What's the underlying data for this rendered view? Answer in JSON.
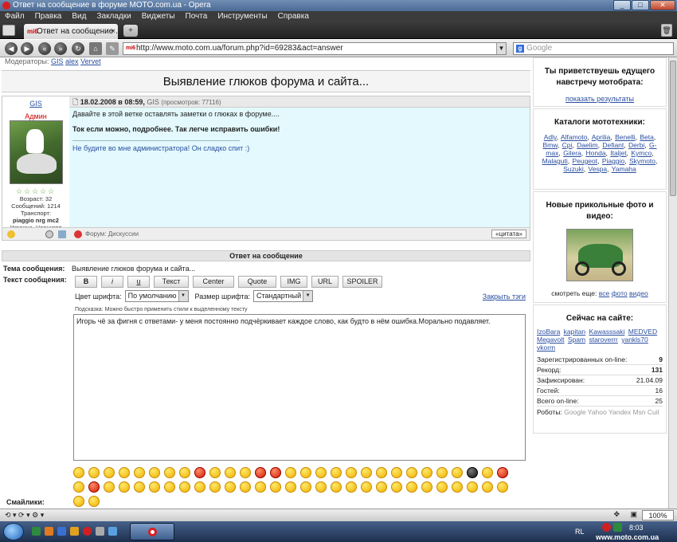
{
  "window": {
    "title": "Ответ на сообщение в форуме MOTO.com.ua - Opera",
    "minimize": "_",
    "maximize": "□",
    "close": "✕"
  },
  "menu": [
    "Файл",
    "Правка",
    "Вид",
    "Закладки",
    "Виджеты",
    "Почта",
    "Инструменты",
    "Справка"
  ],
  "tab": {
    "label": "Ответ на сообщение ...",
    "favicon": "mi6",
    "close": "×",
    "new_tab": "+"
  },
  "address": {
    "url": "http://www.moto.com.ua/forum.php?id=69283&act=answer",
    "favicon": "mi6"
  },
  "search": {
    "placeholder": "Google",
    "engine": "g"
  },
  "nav_icons": [
    "back",
    "forward",
    "rewind",
    "fast-forward",
    "reload",
    "home",
    "wand"
  ],
  "forum": {
    "moderators_label": "Модераторы:",
    "moderators": [
      "GIS",
      "alex",
      "Vervet"
    ],
    "topic_title": "Выявление глюков форума и сайта...",
    "post": {
      "author": "GIS",
      "rank": "Админ",
      "stars": "☆☆☆☆☆",
      "age": "Возраст: 32",
      "posts": "Сообщений: 1214",
      "transport_label": "Транспорт:",
      "transport": "piaggio nrg mc2",
      "location": "Украина, Чернигов",
      "date": "18.02.2008 в 08:59,",
      "date_author": "GIS",
      "views": "(просмотров: 77116)",
      "line1": "Давайте в этой ветке оставлять заметки о глюках в форуме....",
      "line2": "Ток если можно, подробнее. Так легче исправить ошибки!",
      "signature": "Не будите во мне администратора! Он сладко спит :)",
      "forum_label": "Форум: Дискуссии",
      "quote_button": "«цитата»"
    },
    "reply": {
      "header": "Ответ на сообщение",
      "subject_label": "Тема сообщения:",
      "subject": "Выявление глюков форума и сайта...",
      "text_label": "Текст сообщения:",
      "buttons": [
        "B",
        "i",
        "u",
        "Текст",
        "Center",
        "Quote",
        "IMG",
        "URL",
        "SPOILER"
      ],
      "font_color_label": "Цвет шрифта:",
      "font_color_value": "По умолчанию",
      "font_size_label": "Размер шрифта:",
      "font_size_value": "Стандартный",
      "close_tags": "Закрыть тэги",
      "hint": "Подсказка: Можно быстро применить стили к выделенному тексту",
      "message": "Игорь чё за фигня с ответами- у меня постоянно подчёркивает каждое слово, как будто в нём ошибка.Морально подавляет.",
      "smilies_label": "Смайлики:"
    }
  },
  "sidebar": {
    "greeting": "Ты приветствуешь едущего навстречу мотобрата:",
    "show_results": "показать результаты",
    "catalog_title": "Каталоги мототехники:",
    "brands": [
      "Adly",
      "Alfamoto",
      "Aprilia",
      "Benelli",
      "Beta",
      "Bmw",
      "Cpi",
      "Daelim",
      "Defiant",
      "Derbi",
      "G-max",
      "Gilera",
      "Honda",
      "Italjet",
      "Kymco",
      "Malaguti",
      "Peugeot",
      "Piaggio",
      "Skymoto",
      "Suzuki",
      "Vespa",
      "Yamaha"
    ],
    "media_title": "Новые прикольные фото и видео:",
    "see_more_label": "смотреть еще:",
    "see_more_links": [
      "все",
      "фото",
      "видео"
    ],
    "online_title": "Сейчас на сайте:",
    "online_users": [
      "IzoBara",
      "kapitan",
      "Kawasssaki",
      "MEDVED",
      "Megavolt",
      "Spam",
      "staroverrr",
      "yankls70",
      "vkorm"
    ],
    "stats": [
      {
        "label": "Зарегистрированных on-line:",
        "value": "9"
      },
      {
        "label": "Рекорд:",
        "value": "131"
      },
      {
        "label": "Зафиксирован:",
        "value": "21.04.09"
      },
      {
        "label": "Гостей:",
        "value": "16"
      },
      {
        "label": "Всего on-line:",
        "value": "25"
      }
    ],
    "robots_label": "Роботы:",
    "robots": "Google Yahoo Yandex Msn Cuil"
  },
  "statusbar": {
    "zoom": "100%"
  },
  "taskbar": {
    "lang": "RL",
    "clock": "8:03",
    "watermark": "www.moto.com.ua"
  },
  "colors": {
    "link": "#2b4fa0",
    "post_bg": "#e3f9fd",
    "rank": "#cc0000"
  }
}
